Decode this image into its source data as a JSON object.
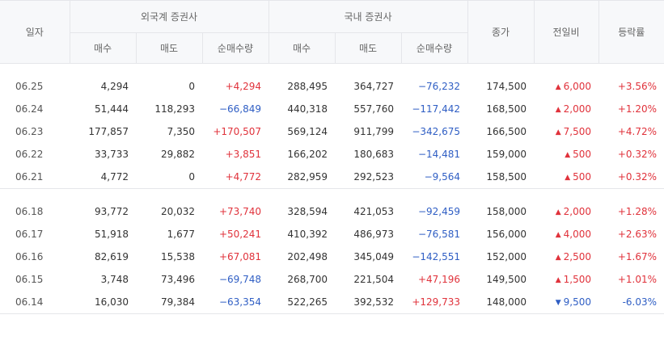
{
  "header": {
    "date": "일자",
    "foreign_group": "외국계 증권사",
    "domestic_group": "국내 증권사",
    "close": "종가",
    "change": "전일비",
    "rate": "등락률",
    "buy": "매수",
    "sell": "매도",
    "net": "순매수량"
  },
  "colors": {
    "up": "#e0323b",
    "down": "#2f5ec4"
  },
  "icons": {
    "up": "triangle-up-icon",
    "down": "triangle-down-icon"
  },
  "blocks": [
    [
      {
        "date": "06.25",
        "f_buy": "4,294",
        "f_sell": "0",
        "f_net": "+4,294",
        "f_dir": "up",
        "d_buy": "288,495",
        "d_sell": "364,727",
        "d_net": "−76,232",
        "d_dir": "down",
        "close": "174,500",
        "chg_dir": "up",
        "chg": "6,000",
        "rate": "+3.56%"
      },
      {
        "date": "06.24",
        "f_buy": "51,444",
        "f_sell": "118,293",
        "f_net": "−66,849",
        "f_dir": "down",
        "d_buy": "440,318",
        "d_sell": "557,760",
        "d_net": "−117,442",
        "d_dir": "down",
        "close": "168,500",
        "chg_dir": "up",
        "chg": "2,000",
        "rate": "+1.20%"
      },
      {
        "date": "06.23",
        "f_buy": "177,857",
        "f_sell": "7,350",
        "f_net": "+170,507",
        "f_dir": "up",
        "d_buy": "569,124",
        "d_sell": "911,799",
        "d_net": "−342,675",
        "d_dir": "down",
        "close": "166,500",
        "chg_dir": "up",
        "chg": "7,500",
        "rate": "+4.72%"
      },
      {
        "date": "06.22",
        "f_buy": "33,733",
        "f_sell": "29,882",
        "f_net": "+3,851",
        "f_dir": "up",
        "d_buy": "166,202",
        "d_sell": "180,683",
        "d_net": "−14,481",
        "d_dir": "down",
        "close": "159,000",
        "chg_dir": "up",
        "chg": "500",
        "rate": "+0.32%"
      },
      {
        "date": "06.21",
        "f_buy": "4,772",
        "f_sell": "0",
        "f_net": "+4,772",
        "f_dir": "up",
        "d_buy": "282,959",
        "d_sell": "292,523",
        "d_net": "−9,564",
        "d_dir": "down",
        "close": "158,500",
        "chg_dir": "up",
        "chg": "500",
        "rate": "+0.32%"
      }
    ],
    [
      {
        "date": "06.18",
        "f_buy": "93,772",
        "f_sell": "20,032",
        "f_net": "+73,740",
        "f_dir": "up",
        "d_buy": "328,594",
        "d_sell": "421,053",
        "d_net": "−92,459",
        "d_dir": "down",
        "close": "158,000",
        "chg_dir": "up",
        "chg": "2,000",
        "rate": "+1.28%"
      },
      {
        "date": "06.17",
        "f_buy": "51,918",
        "f_sell": "1,677",
        "f_net": "+50,241",
        "f_dir": "up",
        "d_buy": "410,392",
        "d_sell": "486,973",
        "d_net": "−76,581",
        "d_dir": "down",
        "close": "156,000",
        "chg_dir": "up",
        "chg": "4,000",
        "rate": "+2.63%"
      },
      {
        "date": "06.16",
        "f_buy": "82,619",
        "f_sell": "15,538",
        "f_net": "+67,081",
        "f_dir": "up",
        "d_buy": "202,498",
        "d_sell": "345,049",
        "d_net": "−142,551",
        "d_dir": "down",
        "close": "152,000",
        "chg_dir": "up",
        "chg": "2,500",
        "rate": "+1.67%"
      },
      {
        "date": "06.15",
        "f_buy": "3,748",
        "f_sell": "73,496",
        "f_net": "−69,748",
        "f_dir": "down",
        "d_buy": "268,700",
        "d_sell": "221,504",
        "d_net": "+47,196",
        "d_dir": "up",
        "close": "149,500",
        "chg_dir": "up",
        "chg": "1,500",
        "rate": "+1.01%"
      },
      {
        "date": "06.14",
        "f_buy": "16,030",
        "f_sell": "79,384",
        "f_net": "−63,354",
        "f_dir": "down",
        "d_buy": "522,265",
        "d_sell": "392,532",
        "d_net": "+129,733",
        "d_dir": "up",
        "close": "148,000",
        "chg_dir": "down",
        "chg": "9,500",
        "rate": "-6.03%"
      }
    ]
  ]
}
